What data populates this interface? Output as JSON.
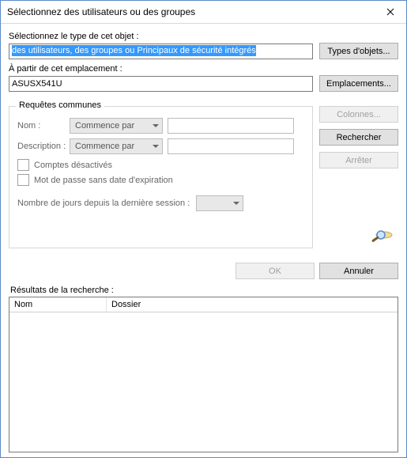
{
  "titlebar": {
    "title": "Sélectionnez des utilisateurs ou des groupes"
  },
  "objectType": {
    "label": "Sélectionnez le type de cet objet :",
    "value": "des utilisateurs, des groupes ou Principaux de sécurité intégrés",
    "button": "Types d'objets..."
  },
  "location": {
    "label": "À partir de cet emplacement :",
    "value": "ASUSX541U",
    "button": "Emplacements..."
  },
  "queries": {
    "legend": "Requêtes communes",
    "name_label": "Nom :",
    "desc_label": "Description :",
    "dropdown_value": "Commence par",
    "chk_disabled": "Comptes désactivés",
    "chk_noexpire": "Mot de passe sans date d'expiration",
    "days_label": "Nombre de jours depuis la dernière session :"
  },
  "sideButtons": {
    "columns": "Colonnes...",
    "search": "Rechercher",
    "stop": "Arrêter"
  },
  "bottom": {
    "ok": "OK",
    "cancel": "Annuler"
  },
  "results": {
    "label": "Résultats de la recherche :",
    "col_name": "Nom",
    "col_folder": "Dossier"
  }
}
